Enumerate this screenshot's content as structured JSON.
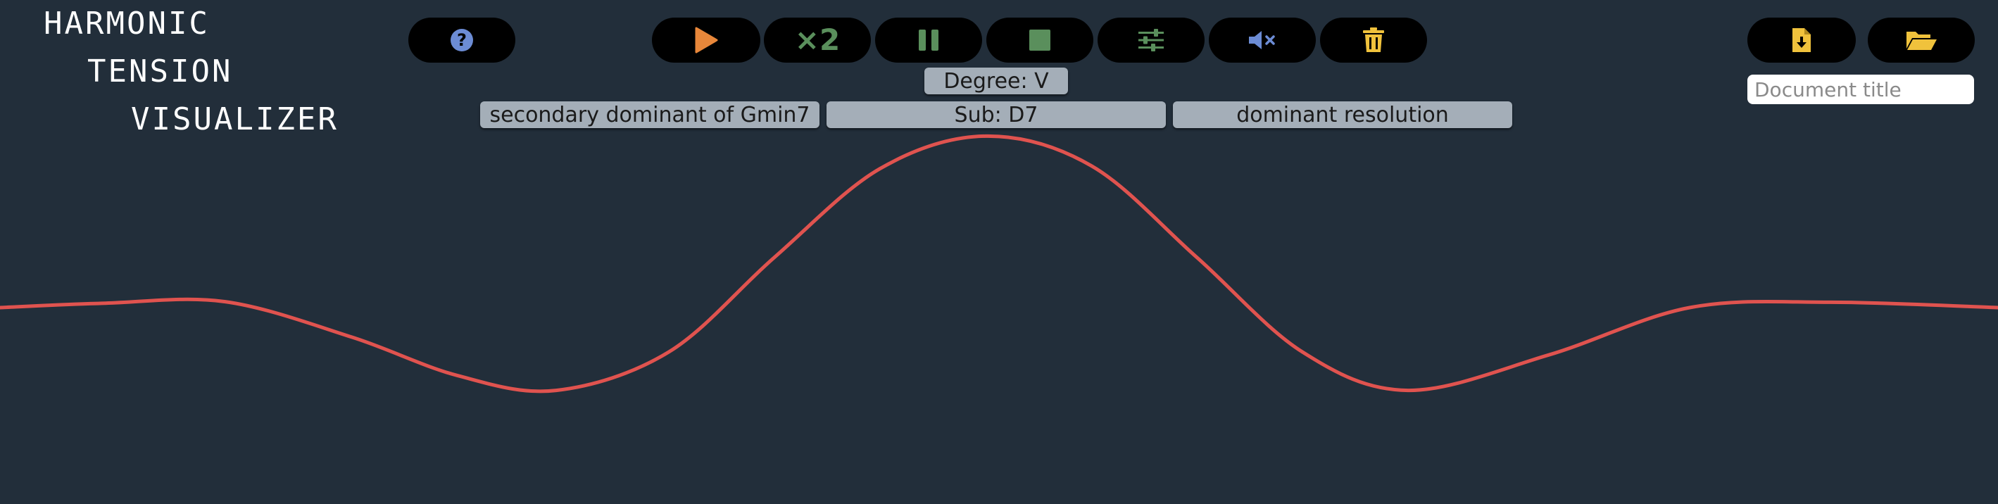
{
  "app": {
    "logo_lines": [
      "HARMONIC",
      "TENSION",
      "VISUALIZER"
    ]
  },
  "toolbar": {
    "help_icon": "question-circle-icon",
    "play_icon": "play-icon",
    "speed_label": "×2",
    "pause_icon": "pause-icon",
    "stop_icon": "stop-icon",
    "settings_icon": "sliders-icon",
    "mute_icon": "volume-mute-icon",
    "delete_icon": "trash-icon",
    "export_icon": "file-download-icon",
    "open_icon": "folder-open-icon"
  },
  "analysis": {
    "degree": "Degree: V",
    "function": "secondary dominant of Gmin7",
    "substitution": "Sub: D7",
    "resolution": "dominant resolution"
  },
  "document": {
    "title_placeholder": "Document title",
    "title_value": ""
  },
  "colors": {
    "background": "#222e3a",
    "button_bg": "#000000",
    "play": "#e8873a",
    "green": "#5a8f5c",
    "blue": "#6c8cd5",
    "yellow": "#f0c23c",
    "wave": "#e0534f",
    "label_bg": "#a4aeb8"
  },
  "chart_data": {
    "type": "line",
    "x": [
      0,
      150,
      320,
      500,
      650,
      790,
      950,
      1100,
      1250,
      1400,
      1550,
      1700,
      1850,
      2000,
      2200,
      2400,
      2600,
      2838
    ],
    "y": [
      0.0,
      0.015,
      0.02,
      -0.1,
      -0.23,
      -0.28,
      -0.15,
      0.17,
      0.47,
      0.58,
      0.48,
      0.17,
      -0.15,
      -0.28,
      -0.16,
      0.0,
      0.018,
      0.0
    ],
    "ylim": [
      -1,
      1
    ],
    "xlabel": "",
    "ylabel": "",
    "grid": false
  }
}
